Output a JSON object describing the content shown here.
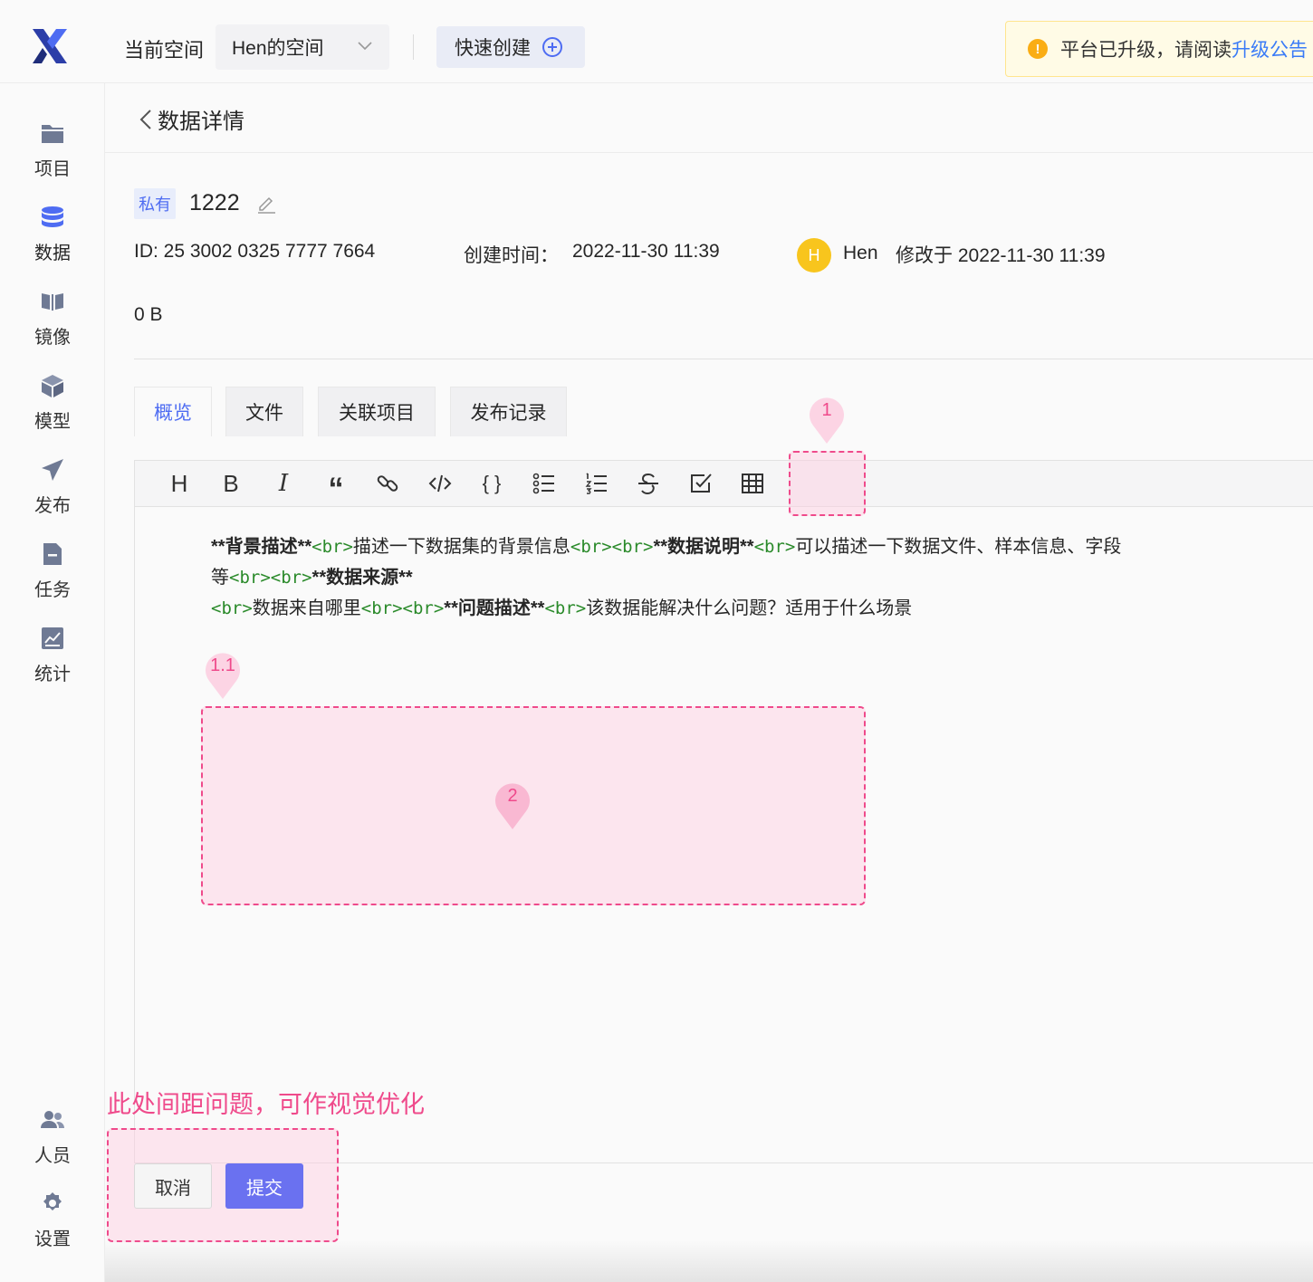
{
  "topbar": {
    "space_label": "当前空间",
    "space_value": "Hen的空间",
    "quick_create": "快速创建",
    "notice_text": "平台已升级，请阅读",
    "notice_link": "升级公告"
  },
  "sidebar": {
    "items": [
      {
        "label": "项目",
        "icon": "folder-icon"
      },
      {
        "label": "数据",
        "icon": "database-icon"
      },
      {
        "label": "镜像",
        "icon": "mirror-icon"
      },
      {
        "label": "模型",
        "icon": "cube-icon"
      },
      {
        "label": "发布",
        "icon": "send-icon"
      },
      {
        "label": "任务",
        "icon": "task-icon"
      },
      {
        "label": "统计",
        "icon": "chart-icon"
      }
    ],
    "bottom_items": [
      {
        "label": "人员",
        "icon": "people-icon"
      },
      {
        "label": "设置",
        "icon": "gear-icon"
      }
    ]
  },
  "page": {
    "title": "数据详情",
    "visibility_tag": "私有",
    "name": "1222",
    "id_text": "ID: 25 3002 0325 7777 7664",
    "created_label": "创建时间：",
    "created_value": "2022-11-30 11:39",
    "avatar_letter": "H",
    "owner": "Hen",
    "modified_text": "修改于 2022-11-30 11:39",
    "size": "0 B"
  },
  "tabs": [
    "概览",
    "文件",
    "关联项目",
    "发布记录"
  ],
  "toolbar": {
    "buttons": [
      "heading",
      "bold",
      "italic",
      "quote",
      "link",
      "code",
      "code-block",
      "bullet-list",
      "ordered-list",
      "strikethrough",
      "checkbox",
      "table"
    ],
    "heading_glyph": "H",
    "bold_glyph": "B",
    "italic_glyph": "I",
    "quote_glyph": "“",
    "codeblock_glyph": "{ }"
  },
  "content": {
    "seg1_bold": "**背景描述**",
    "br": "<br>",
    "seg2": "描述一下数据集的背景信息",
    "seg3_bold": "**数据说明**",
    "seg4": "可以描述一下数据文件、样本信息、字段",
    "seg5": "等",
    "seg6_bold": "**数据来源**",
    "seg7": "数据来自哪里",
    "seg8_bold": "**问题描述**",
    "seg9": "该数据能解决什么问题？适用于什么场景"
  },
  "annotations": {
    "pin1": "1",
    "pin11": "1.1",
    "pin2": "2",
    "note": "此处间距问题，可作视觉优化",
    "color": "#ef4a8b"
  },
  "actions": {
    "cancel": "取消",
    "submit": "提交"
  },
  "colors": {
    "accent": "#4e6cf2",
    "submit": "#6a71f0",
    "avatar": "#f8c51d",
    "warning": "#faad14"
  }
}
